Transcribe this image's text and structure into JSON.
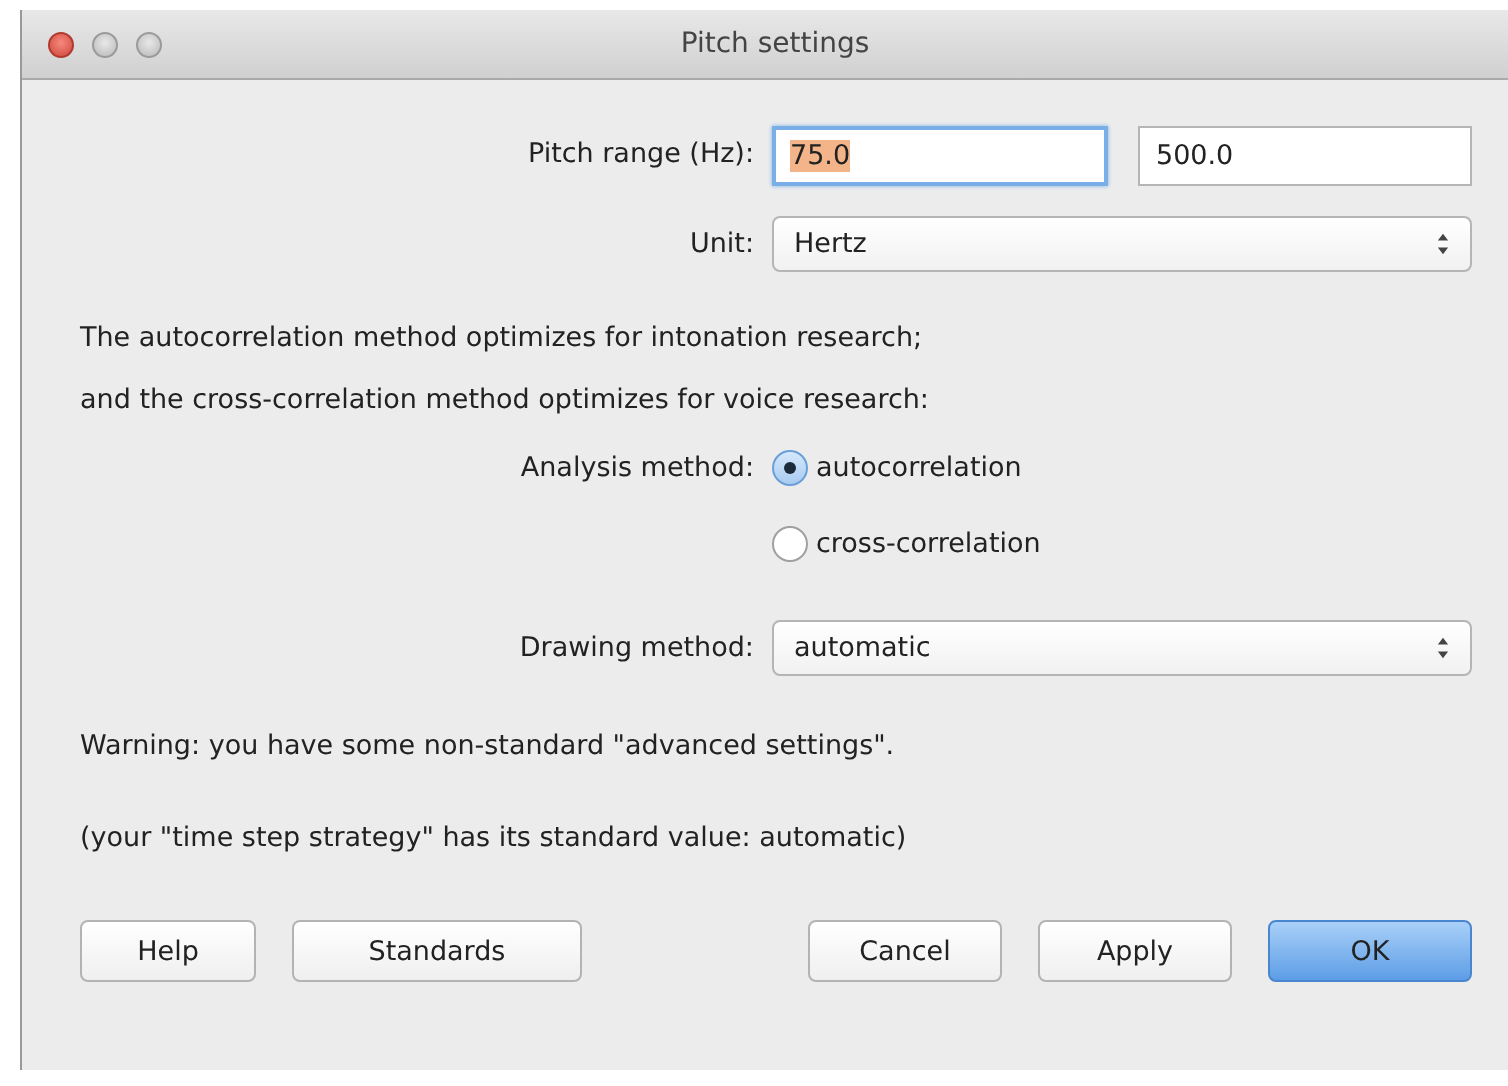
{
  "window": {
    "title": "Pitch settings"
  },
  "pitch_range": {
    "label": "Pitch range (Hz):",
    "fields": [
      {
        "value": "75.0",
        "focused": true
      },
      {
        "value": "500.0",
        "focused": false
      }
    ]
  },
  "unit": {
    "label": "Unit:",
    "value": "Hertz"
  },
  "description": [
    "The autocorrelation method optimizes for intonation research;",
    "and the cross-correlation method optimizes for voice research:"
  ],
  "analysis_method": {
    "label": "Analysis method:",
    "options": [
      {
        "label": "autocorrelation",
        "selected": true
      },
      {
        "label": "cross-correlation",
        "selected": false
      }
    ]
  },
  "drawing_method": {
    "label": "Drawing method:",
    "value": "automatic"
  },
  "warning": "Warning: you have some non-standard \"advanced settings\".",
  "note": "(your \"time step strategy\" has its standard value: automatic)",
  "buttons_left": [
    {
      "label": "Help",
      "default": false
    },
    {
      "label": "Standards",
      "default": false
    }
  ],
  "buttons_right": [
    {
      "label": "Cancel",
      "default": false
    },
    {
      "label": "Apply",
      "default": false
    },
    {
      "label": "OK",
      "default": true
    }
  ]
}
